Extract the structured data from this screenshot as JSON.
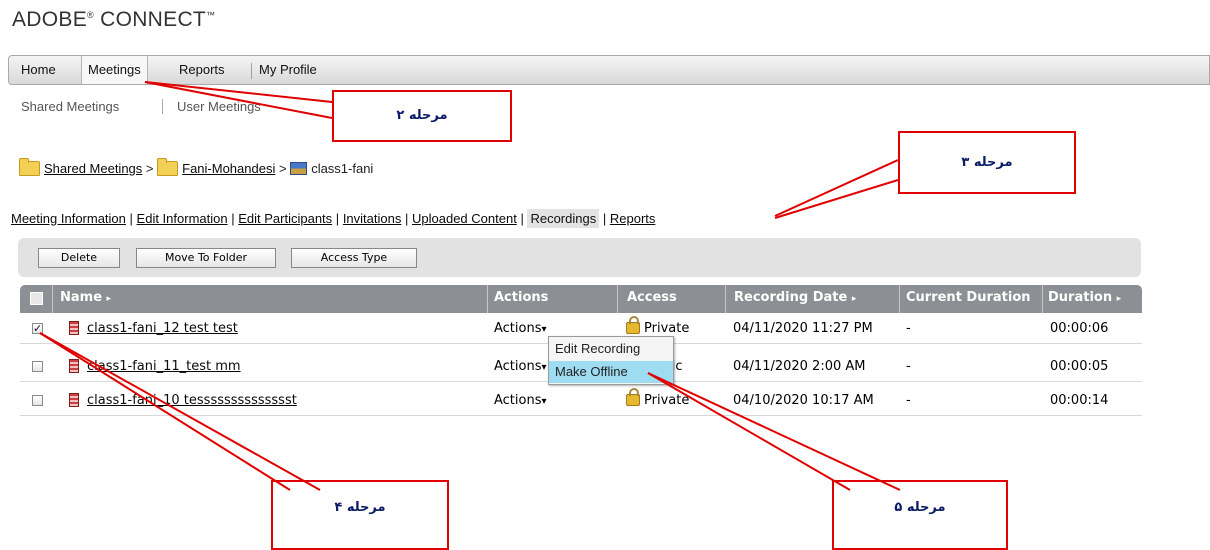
{
  "logo": {
    "text": "ADOBE",
    "reg": "®",
    "text2": " CONNECT",
    "tm": "™"
  },
  "nav": {
    "home": "Home",
    "meetings": "Meetings",
    "reports": "Reports",
    "profile": "My Profile"
  },
  "subnav": {
    "shared": "Shared Meetings",
    "user": "User Meetings"
  },
  "breadcrumb": {
    "item1": "Shared Meetings",
    "item2": "Fani-Mohandesi",
    "item3": "class1-fani",
    "sep": ">"
  },
  "tabs": [
    "Meeting Information",
    "Edit Information",
    "Edit Participants",
    "Invitations",
    "Uploaded Content",
    "Recordings",
    "Reports"
  ],
  "tab_sep": "|",
  "toolbar": {
    "delete": "Delete",
    "move": "Move To Folder",
    "access": "Access Type"
  },
  "table": {
    "headers": {
      "name": "Name",
      "actions": "Actions",
      "access": "Access",
      "date": "Recording Date",
      "current": "Current Duration",
      "duration": "Duration"
    },
    "header_arrow": "▸",
    "rows": [
      {
        "checked": true,
        "name": "class1-fani_12 test test",
        "actions": "Actions",
        "access": "Private",
        "date": "04/11/2020 11:27 PM",
        "current": "-",
        "duration": "00:00:06"
      },
      {
        "checked": false,
        "name": "class1-fani_11_test mm",
        "actions": "Actions",
        "access": "Public",
        "date": "04/11/2020 2:00 AM",
        "current": "-",
        "duration": "00:00:05"
      },
      {
        "checked": false,
        "name": "class1-fani_10 tesssssssssssssst",
        "actions": "Actions",
        "access": "Private",
        "date": "04/10/2020 10:17 AM",
        "current": "-",
        "duration": "00:00:14"
      }
    ],
    "actions_arrow": "▾"
  },
  "context_menu": {
    "edit": "Edit Recording",
    "offline": "Make Offline"
  },
  "callouts": {
    "step2": "مرحله ۲",
    "step3": "مرحله ۳",
    "step4": "مرحله ۴",
    "step5": "مرحله ۵"
  },
  "colors": {
    "callout_border": "#e00000",
    "callout_text": "#0a1a66",
    "menu_highlight": "#9edcf1",
    "header_bg": "#8c8f93"
  }
}
